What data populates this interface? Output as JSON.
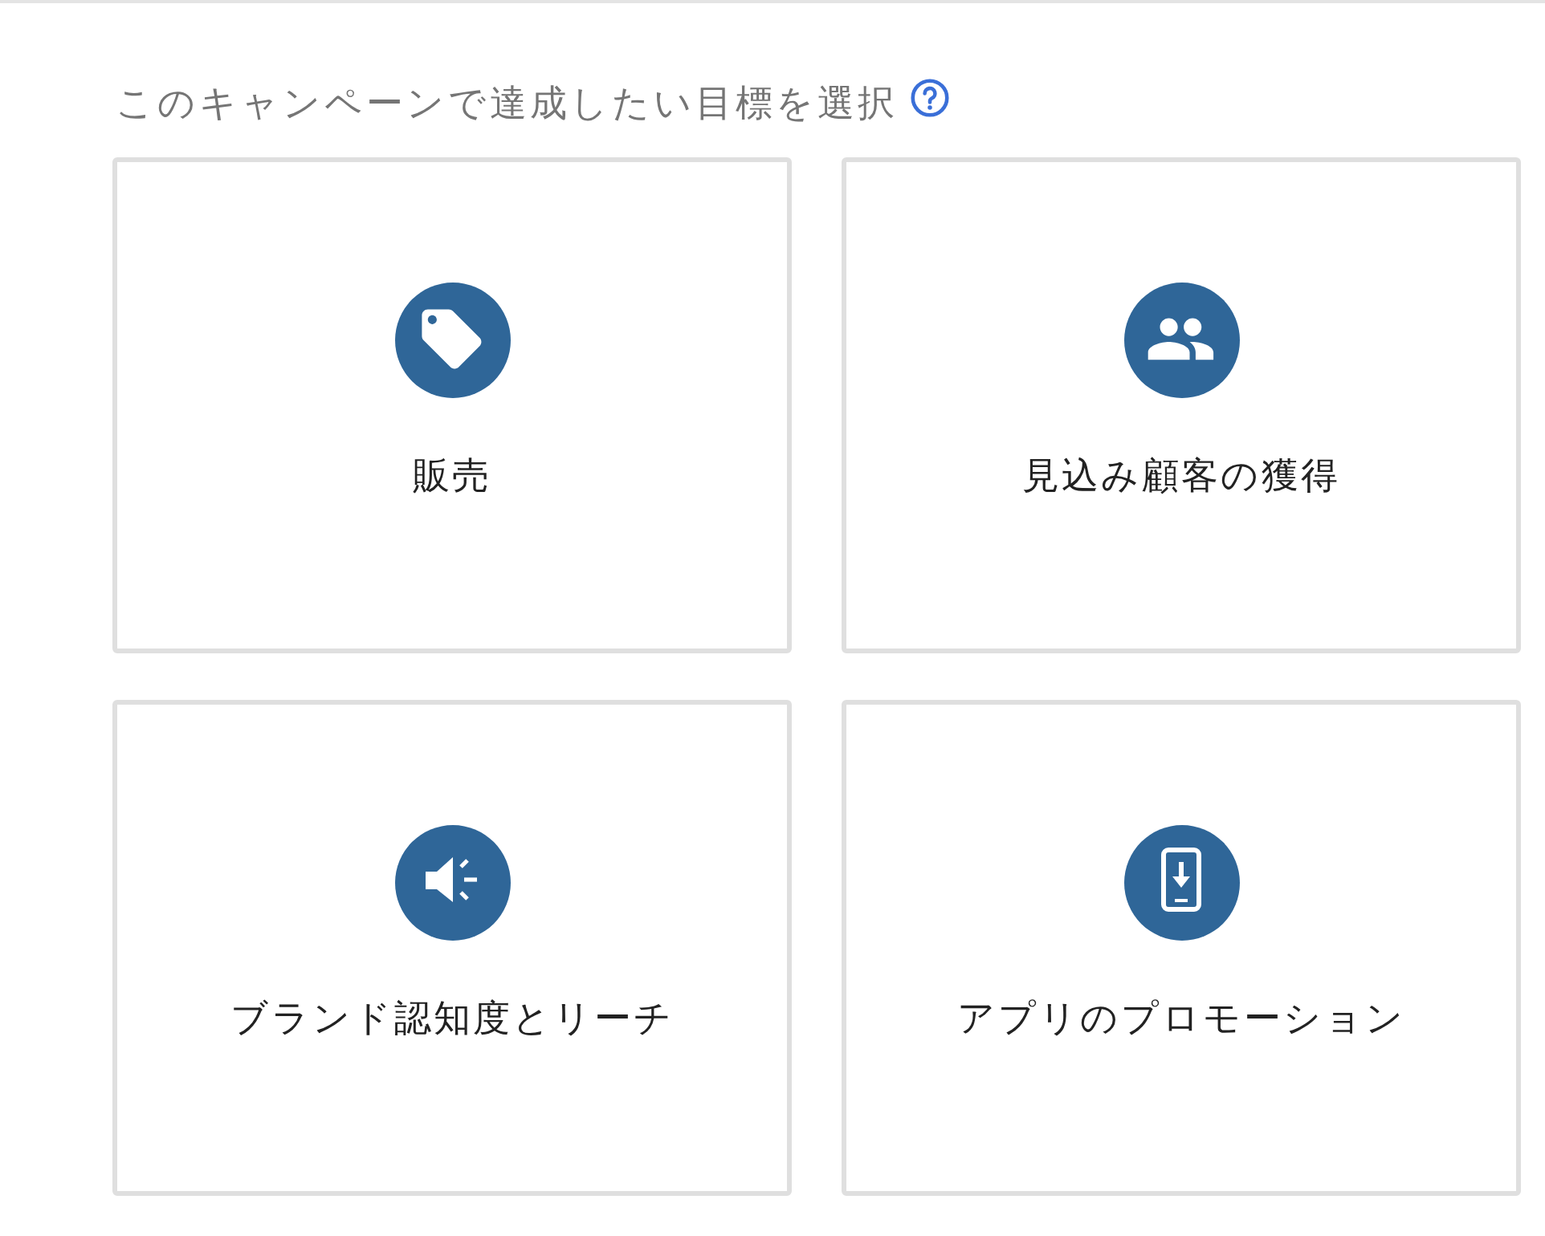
{
  "heading": {
    "text": "このキャンペーンで達成したい目標を選択"
  },
  "goals": [
    {
      "label": "販売",
      "selected": false
    },
    {
      "label": "見込み顧客の獲得",
      "selected": false
    },
    {
      "label": "ブランド認知度とリーチ",
      "selected": false
    },
    {
      "label": "アプリのプロモーション",
      "selected": false
    }
  ]
}
